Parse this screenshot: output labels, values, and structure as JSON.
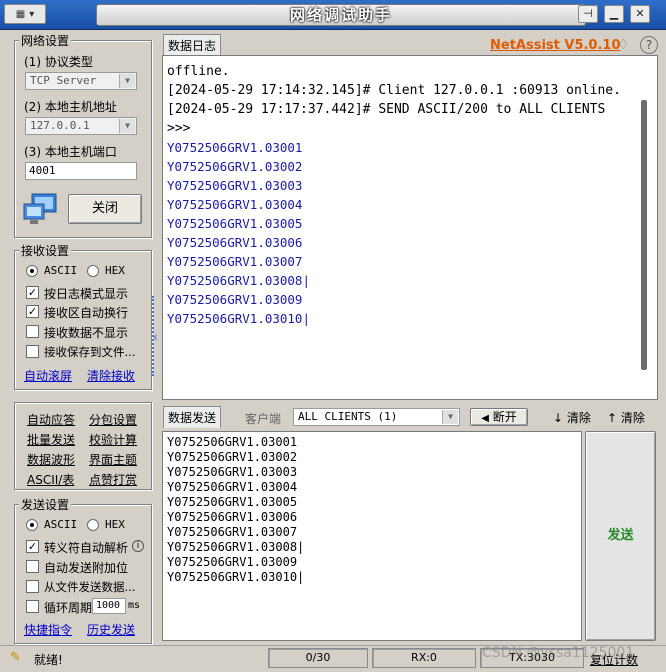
{
  "titlebar": {
    "title": "网络调试助手",
    "buttons": [
      "pin",
      "min",
      "close"
    ]
  },
  "brand": {
    "text": "NetAssist V5.0.10",
    "color": "#e05a00"
  },
  "network": {
    "group_title": "网络设置",
    "protocol_label": "(1) 协议类型",
    "protocol_value": "TCP Server",
    "host_label": "(2) 本地主机地址",
    "host_value": "127.0.0.1",
    "port_label": "(3) 本地主机端口",
    "port_value": "4001",
    "close_button": "关闭"
  },
  "receive": {
    "group_title": "接收设置",
    "radio_ascii": "ASCII",
    "radio_hex": "HEX",
    "opt_log_mode": "按日志模式显示",
    "opt_auto_wrap": "接收区自动换行",
    "opt_no_display": "接收数据不显示",
    "opt_save_file": "接收保存到文件...",
    "link_autoscroll": "自动滚屏",
    "link_clear": "清除接收"
  },
  "tools": {
    "items": [
      "自动应答",
      "分包设置",
      "批量发送",
      "校验计算",
      "数据波形",
      "界面主题",
      "ASCII/表",
      "点赞打赏"
    ]
  },
  "send": {
    "group_title": "发送设置",
    "radio_ascii": "ASCII",
    "radio_hex": "HEX",
    "opt_escape": "转义符自动解析",
    "opt_append": "自动发送附加位",
    "opt_from_file": "从文件发送数据...",
    "opt_loop": "循环周期",
    "loop_value": "1000",
    "loop_unit": "ms",
    "link_shortcut": "快捷指令",
    "link_history": "历史发送"
  },
  "log": {
    "tab_label": "数据日志",
    "lines": [
      "offline.",
      "",
      "[2024-05-29 17:14:32.145]# Client 127.0.0.1 :60913 online.",
      "",
      "[2024-05-29 17:17:37.442]# SEND ASCII/200 to ALL CLIENTS",
      ">>>"
    ],
    "data_lines": [
      "Y0752506GRV1.03001",
      "Y0752506GRV1.03002",
      "Y0752506GRV1.03003",
      "Y0752506GRV1.03004",
      "Y0752506GRV1.03005",
      "Y0752506GRV1.03006",
      "Y0752506GRV1.03007",
      "Y0752506GRV1.03008|",
      "Y0752506GRV1.03009",
      "Y0752506GRV1.03010|"
    ]
  },
  "sendarea": {
    "tab_label": "数据发送",
    "client_label": "客户端",
    "client_value": "ALL CLIENTS (1)",
    "disconnect": "断开",
    "clear1": "清除",
    "clear2": "清除",
    "send_button": "发送",
    "lines": [
      "Y0752506GRV1.03001",
      "Y0752506GRV1.03002",
      "Y0752506GRV1.03003",
      "Y0752506GRV1.03004",
      "Y0752506GRV1.03005",
      "Y0752506GRV1.03006",
      "Y0752506GRV1.03007",
      "Y0752506GRV1.03008|",
      "Y0752506GRV1.03009",
      "Y0752506GRV1.03010|"
    ]
  },
  "status": {
    "ready": "就绪!",
    "count": "0/30",
    "rx": "RX:0",
    "tx": "TX:3030",
    "reset": "复位计数",
    "watermark": "CSDN @yssa1125001"
  }
}
